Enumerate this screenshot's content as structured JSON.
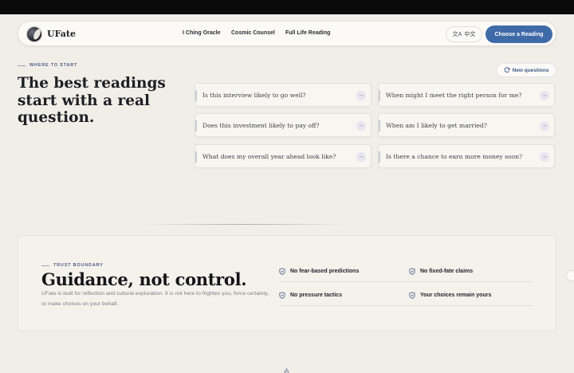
{
  "nav": {
    "brand": "UFate",
    "links": [
      "I Ching Oracle",
      "Cosmic Counsel",
      "Full Life Reading"
    ],
    "lang_label": "中文",
    "cta_label": "Choose a Reading"
  },
  "hero": {
    "eyebrow": "WHERE TO START",
    "title": "The best readings start with a real question.",
    "new_questions_label": "New questions",
    "questions": [
      "Is this interview likely to go well?",
      "When might I meet the right person for me?",
      "Does this investment likely to pay off?",
      "When am I likely to get married?",
      "What does my overall year ahead look like?",
      "Is there a chance to earn more money soon?"
    ]
  },
  "trust": {
    "eyebrow": "TRUST BOUNDARY",
    "title": "Guidance, not control.",
    "body": "UFate is built for reflection and cultural exploration. It is not here to frighten you, force certainty, or make choices on your behalf.",
    "points": [
      "No fear-based predictions",
      "No fixed-fate claims",
      "No pressure tactics",
      "Your choices remain yours"
    ]
  },
  "colors": {
    "accent": "#3f6aa8",
    "background": "#f1eee8",
    "eyebrow": "#4a5e86"
  },
  "icons": {
    "logo": "yin-yang-logo",
    "lang": "translate-icon",
    "refresh": "refresh-icon",
    "arrow": "arrow-right-icon",
    "shield": "shield-check-icon"
  }
}
